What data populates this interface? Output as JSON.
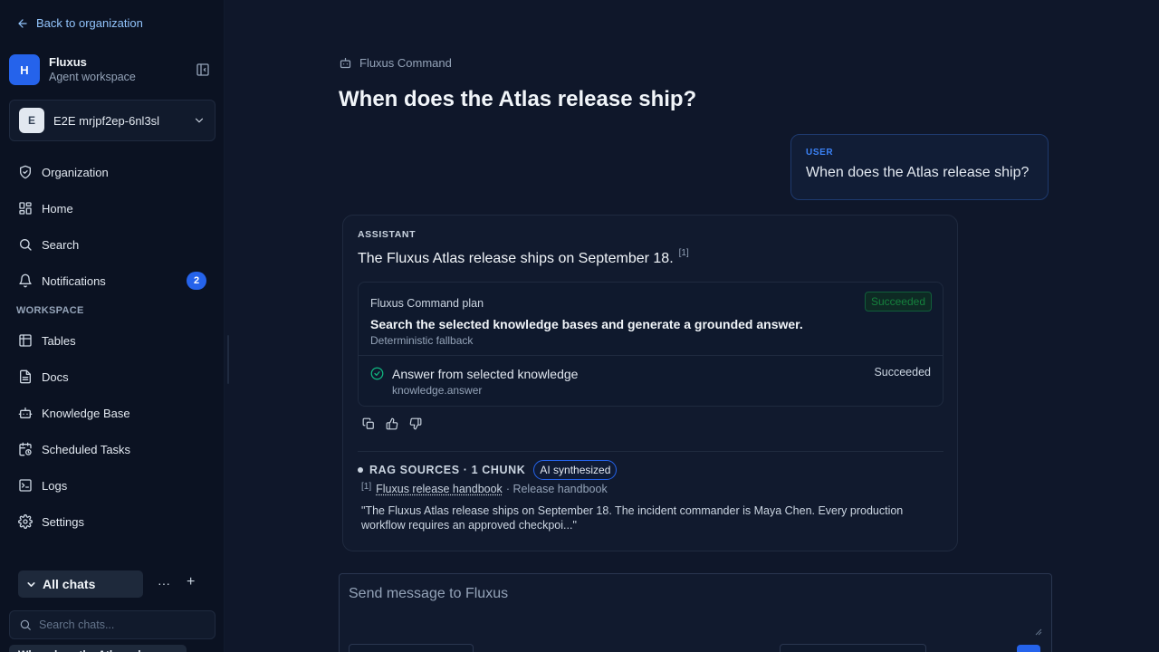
{
  "sidebar": {
    "back_label": "Back to organization",
    "brand": {
      "initial": "H",
      "name": "Fluxus",
      "subtitle": "Agent workspace"
    },
    "workspace": {
      "initial": "E",
      "name": "E2E mrjpf2ep-6nl3sl"
    },
    "nav_items": [
      {
        "label": "Organization",
        "icon": "shield-icon"
      },
      {
        "label": "Home",
        "icon": "grid-icon"
      },
      {
        "label": "Search",
        "icon": "search-icon"
      },
      {
        "label": "Notifications",
        "icon": "bell-icon",
        "badge": "2"
      }
    ],
    "section_label": "WORKSPACE",
    "workspace_items": [
      {
        "label": "Tables",
        "icon": "table-icon"
      },
      {
        "label": "Docs",
        "icon": "document-icon"
      },
      {
        "label": "Knowledge Base",
        "icon": "robot-icon"
      },
      {
        "label": "Scheduled Tasks",
        "icon": "calendar-clock-icon"
      },
      {
        "label": "Logs",
        "icon": "terminal-icon"
      },
      {
        "label": "Settings",
        "icon": "gear-icon"
      }
    ],
    "chats": {
      "toggle_label": "All chats",
      "more_label": "···",
      "add_label": "+",
      "search_placeholder": "Search chats...",
      "first_chat": "When does the Atlas release..."
    }
  },
  "main": {
    "agent_label": "Fluxus Command",
    "title": "When does the Atlas release ship?",
    "user_message": {
      "role": "USER",
      "text": "When does the Atlas release ship?"
    },
    "assistant": {
      "role": "ASSISTANT",
      "answer": "The Fluxus Atlas release ships on September 18.",
      "citation": "[1]",
      "plan": {
        "name": "Fluxus Command plan",
        "status": "Succeeded",
        "title": "Search the selected knowledge bases and generate a grounded answer.",
        "subtitle": "Deterministic fallback",
        "step": {
          "title": "Answer from selected knowledge",
          "code": "knowledge.answer",
          "status": "Succeeded"
        }
      },
      "rag": {
        "label": "RAG SOURCES · 1 CHUNK",
        "chip": "AI synthesized",
        "source_num": "[1]",
        "source_title": "Fluxus release handbook",
        "source_meta": "· Release handbook",
        "quote": "\"The Fluxus Atlas release ships on September 18. The incident commander is Maya Chen. Every production workflow requires an approved checkpoi...\""
      }
    },
    "composer": {
      "placeholder": "Send message to Fluxus"
    }
  },
  "colors": {
    "background": "#0f172a",
    "sidebar": "#0b1222",
    "accent": "#2563eb",
    "success": "#10b981"
  }
}
